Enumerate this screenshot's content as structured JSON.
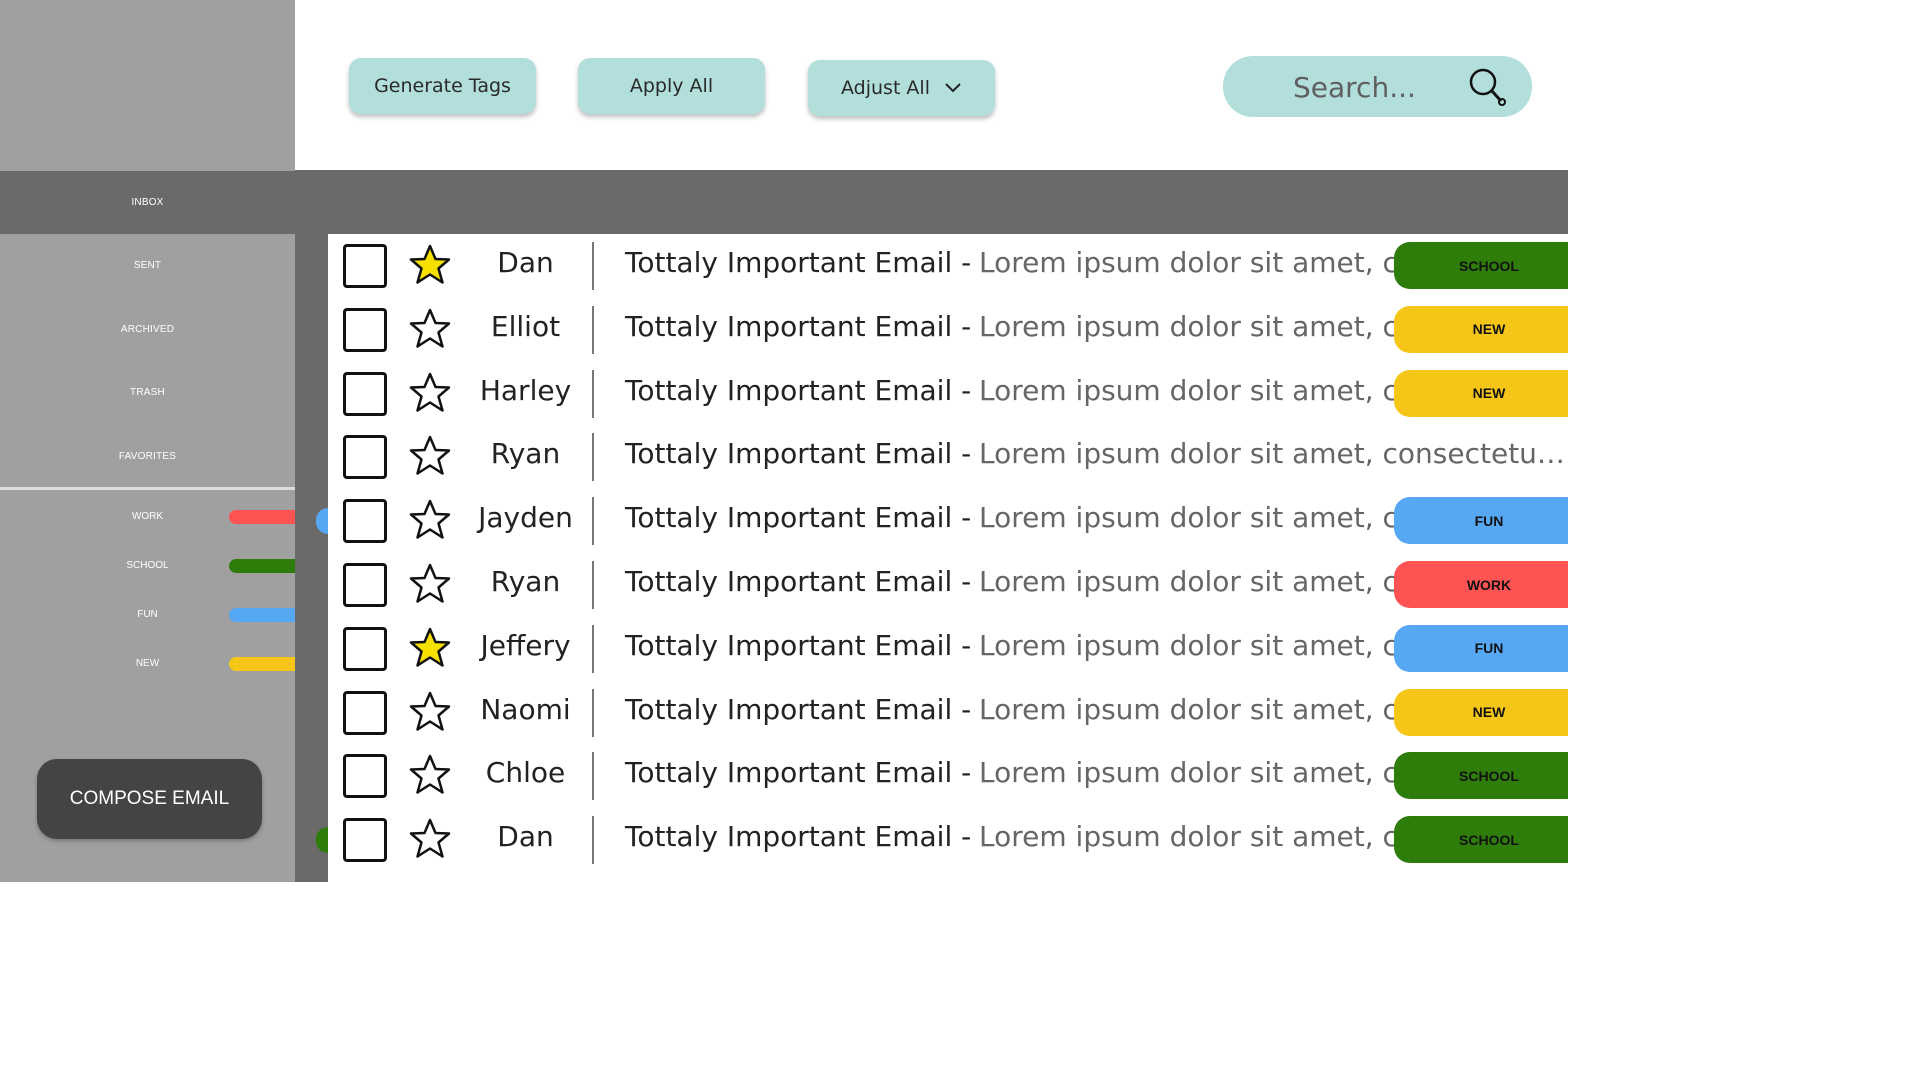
{
  "toolbar": {
    "generate_label": "Generate Tags",
    "apply_label": "Apply All",
    "adjust_label": "Adjust All",
    "search_placeholder": "Search..."
  },
  "sidebar": {
    "nav": [
      {
        "label": "INBOX",
        "active": true
      },
      {
        "label": "SENT",
        "active": false
      },
      {
        "label": "ARCHIVED",
        "active": false
      },
      {
        "label": "TRASH",
        "active": false
      },
      {
        "label": "FAVORITES",
        "active": false
      }
    ],
    "tags": [
      {
        "label": "WORK",
        "color": "#ff5252"
      },
      {
        "label": "SCHOOL",
        "color": "#2e7d0a"
      },
      {
        "label": "FUN",
        "color": "#56a8f5"
      },
      {
        "label": "NEW",
        "color": "#f5c518"
      }
    ],
    "compose_label": "COMPOSE EMAIL"
  },
  "colors": {
    "sidebar": "#a0a0a0",
    "active_nav": "#6a6a6a",
    "button": "#b2dfdb",
    "compose": "#444444",
    "star_filled": "#f5e000"
  },
  "emails": [
    {
      "sender": "Dan",
      "starred": true,
      "subject": "Tottaly Important Email -",
      "preview": "Lorem ipsum dolor sit amet, consectetur...",
      "tag": "SCHOOL"
    },
    {
      "sender": "Elliot",
      "starred": false,
      "subject": "Tottaly Important Email -",
      "preview": "Lorem ipsum dolor sit amet, consectetur...",
      "tag": "NEW"
    },
    {
      "sender": "Harley",
      "starred": false,
      "subject": "Tottaly Important Email -",
      "preview": "Lorem ipsum dolor sit amet, consectetur...",
      "tag": "NEW"
    },
    {
      "sender": "Ryan",
      "starred": false,
      "subject": "Tottaly Important Email -",
      "preview": "Lorem ipsum dolor sit amet, consectetur...",
      "tag": ""
    },
    {
      "sender": "Jayden",
      "starred": false,
      "subject": "Tottaly Important Email -",
      "preview": "Lorem ipsum dolor sit amet, consectetur...",
      "tag": "FUN"
    },
    {
      "sender": "Ryan",
      "starred": false,
      "subject": "Tottaly Important Email -",
      "preview": "Lorem ipsum dolor sit amet, consectetur...",
      "tag": "WORK"
    },
    {
      "sender": "Jeffery",
      "starred": true,
      "subject": "Tottaly Important Email -",
      "preview": "Lorem ipsum dolor sit amet, consectetur...",
      "tag": "FUN"
    },
    {
      "sender": "Naomi",
      "starred": false,
      "subject": "Tottaly Important Email -",
      "preview": "Lorem ipsum dolor sit amet, consectetur...",
      "tag": "NEW"
    },
    {
      "sender": "Chloe",
      "starred": false,
      "subject": "Tottaly Important Email -",
      "preview": "Lorem ipsum dolor sit amet, consectetur...",
      "tag": "SCHOOL"
    },
    {
      "sender": "Dan",
      "starred": false,
      "subject": "Tottaly Important Email -",
      "preview": "Lorem ipsum dolor sit amet, consectetur...",
      "tag": "SCHOOL"
    }
  ]
}
